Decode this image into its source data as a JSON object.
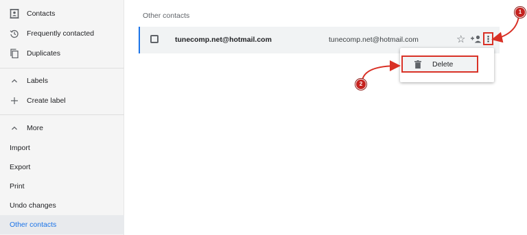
{
  "sidebar": {
    "items": [
      {
        "label": "Contacts",
        "icon": "contacts-icon"
      },
      {
        "label": "Frequently contacted",
        "icon": "history-icon"
      },
      {
        "label": "Duplicates",
        "icon": "copy-icon"
      }
    ],
    "labels_section": {
      "label": "Labels",
      "icon": "chevron-up-icon"
    },
    "create_label": {
      "label": "Create label",
      "icon": "plus-icon"
    },
    "more_section": {
      "label": "More",
      "icon": "chevron-up-icon"
    },
    "more_items": [
      {
        "label": "Import"
      },
      {
        "label": "Export"
      },
      {
        "label": "Print"
      },
      {
        "label": "Undo changes"
      },
      {
        "label": "Other contacts",
        "active": true
      }
    ]
  },
  "main": {
    "section_title": "Other contacts",
    "row": {
      "name": "tunecomp.net@hotmail.com",
      "email": "tunecomp.net@hotmail.com",
      "star_icon": "star-outline-icon",
      "add_icon": "add-person-icon",
      "more_icon": "more-vert-icon"
    },
    "menu": {
      "items": [
        {
          "label": "Delete",
          "icon": "trash-icon"
        }
      ]
    }
  },
  "annotations": {
    "badge_1": "1",
    "badge_2": "2",
    "highlight_color": "#d93025"
  },
  "colors": {
    "accent": "#1a73e8",
    "sidebar_bg": "#f5f5f5",
    "row_bg": "#f1f3f4"
  }
}
